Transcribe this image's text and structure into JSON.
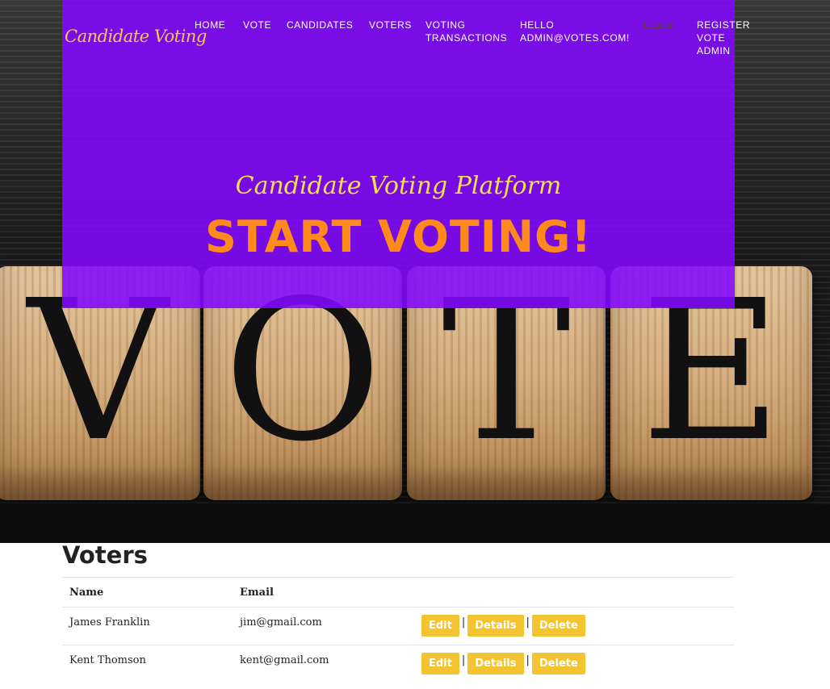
{
  "brand": "Candidate Voting",
  "nav": {
    "home": "HOME",
    "vote": "VOTE",
    "candidates": "CANDIDATES",
    "voters": "VOTERS",
    "transactions": "VOTING TRANSACTIONS",
    "hello": "HELLO ADMIN@VOTES.COM!",
    "logout": "Logout",
    "register": "REGISTER VOTE ADMIN"
  },
  "hero": {
    "subtitle": "Candidate Voting Platform",
    "title": "START VOTING!",
    "image_letters": [
      "V",
      "O",
      "T",
      "E"
    ]
  },
  "voters": {
    "title": "Voters",
    "columns": {
      "name": "Name",
      "email": "Email"
    },
    "rows": [
      {
        "name": "James Franklin",
        "email": "jim@gmail.com"
      },
      {
        "name": "Kent Thomson",
        "email": "kent@gmail.com"
      }
    ],
    "actions": {
      "edit": "Edit",
      "details": "Details",
      "delete": "Delete",
      "separator": "|"
    }
  },
  "colors": {
    "overlay": "#8208ff",
    "brand": "#f4c84a",
    "subtitle": "#f4df4a",
    "title": "#ff8a1c",
    "button": "#f4c430"
  }
}
